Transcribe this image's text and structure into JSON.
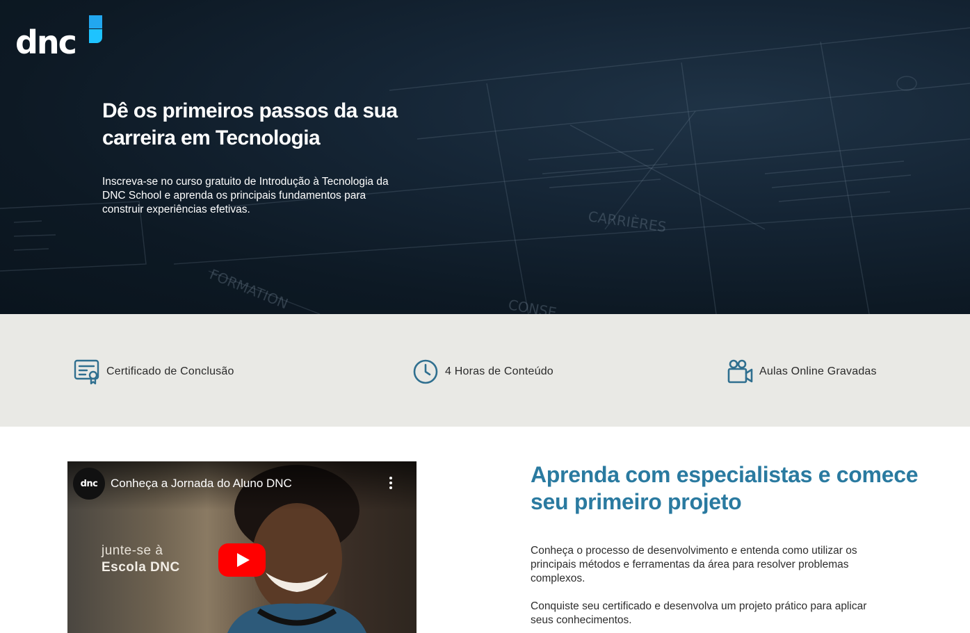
{
  "brand": {
    "logo_text": "dnc",
    "accent": "#22a7ef"
  },
  "hero": {
    "title": "Dê os primeiros passos da sua carreira em Tecnologia",
    "description": "Inscreva-se no curso gratuito de Introdução à Tecnologia da DNC School e aprenda os principais fundamentos para construir experiências efetivas."
  },
  "features": [
    {
      "icon": "certificate-icon",
      "label": "Certificado de Conclusão"
    },
    {
      "icon": "clock-icon",
      "label": "4 Horas de Conteúdo"
    },
    {
      "icon": "video-camera-icon",
      "label": "Aulas Online Gravadas"
    }
  ],
  "video": {
    "channel_avatar_text": "dnc",
    "title": "Conheça a Jornada do Aluno DNC",
    "overlay_line1": "junte-se à",
    "overlay_line2": "Escola DNC"
  },
  "section": {
    "title": "Aprenda com especialistas e comece seu primeiro projeto",
    "paragraph1": "Conheça o processo de desenvolvimento e entenda como utilizar os principais métodos e ferramentas da área para resolver problemas complexos.",
    "paragraph2": "Conquiste seu certificado e desenvolva um projeto prático para aplicar seus conhecimentos."
  },
  "colors": {
    "title_blue": "#2a7aa0",
    "icon_blue": "#2f6f8f",
    "feature_bg": "#e9e9e5",
    "hero_bg": "#0d1924"
  }
}
